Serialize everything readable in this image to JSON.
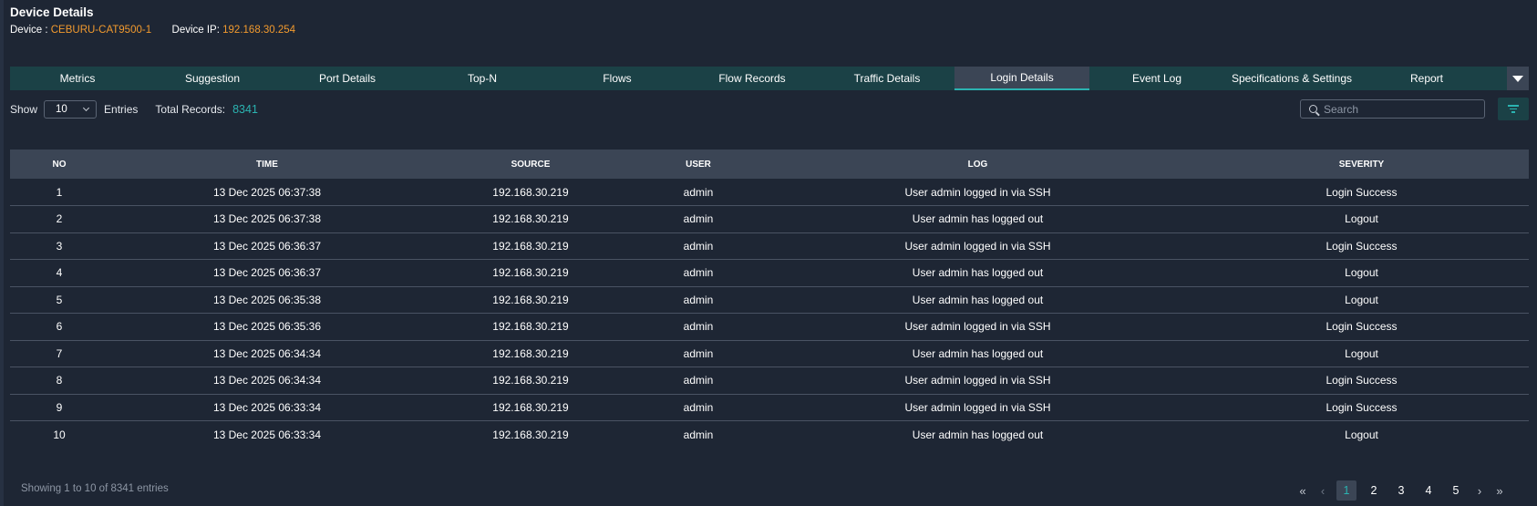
{
  "header": {
    "title": "Device Details",
    "device_label": "Device :",
    "device_value": "CEBURU-CAT9500-1",
    "ip_label": "Device IP:",
    "ip_value": "192.168.30.254"
  },
  "tabs": [
    "Metrics",
    "Suggestion",
    "Port Details",
    "Top-N",
    "Flows",
    "Flow Records",
    "Traffic Details",
    "Login Details",
    "Event Log",
    "Specifications & Settings",
    "Report"
  ],
  "active_tab": "Login Details",
  "controls": {
    "show_label": "Show",
    "entries_value": "10",
    "entries_label": "Entries",
    "total_label": "Total Records:",
    "total_value": "8341",
    "search_placeholder": "Search"
  },
  "table": {
    "columns": [
      "NO",
      "TIME",
      "SOURCE",
      "USER",
      "LOG",
      "SEVERITY"
    ],
    "rows": [
      [
        "1",
        "13 Dec 2025 06:37:38",
        "192.168.30.219",
        "admin",
        "User admin logged in via SSH",
        "Login Success"
      ],
      [
        "2",
        "13 Dec 2025 06:37:38",
        "192.168.30.219",
        "admin",
        "User admin has logged out",
        "Logout"
      ],
      [
        "3",
        "13 Dec 2025 06:36:37",
        "192.168.30.219",
        "admin",
        "User admin logged in via SSH",
        "Login Success"
      ],
      [
        "4",
        "13 Dec 2025 06:36:37",
        "192.168.30.219",
        "admin",
        "User admin has logged out",
        "Logout"
      ],
      [
        "5",
        "13 Dec 2025 06:35:38",
        "192.168.30.219",
        "admin",
        "User admin has logged out",
        "Logout"
      ],
      [
        "6",
        "13 Dec 2025 06:35:36",
        "192.168.30.219",
        "admin",
        "User admin logged in via SSH",
        "Login Success"
      ],
      [
        "7",
        "13 Dec 2025 06:34:34",
        "192.168.30.219",
        "admin",
        "User admin has logged out",
        "Logout"
      ],
      [
        "8",
        "13 Dec 2025 06:34:34",
        "192.168.30.219",
        "admin",
        "User admin logged in via SSH",
        "Login Success"
      ],
      [
        "9",
        "13 Dec 2025 06:33:34",
        "192.168.30.219",
        "admin",
        "User admin logged in via SSH",
        "Login Success"
      ],
      [
        "10",
        "13 Dec 2025 06:33:34",
        "192.168.30.219",
        "admin",
        "User admin has logged out",
        "Logout"
      ]
    ]
  },
  "footer": {
    "showing_text": "Showing 1 to 10 of 8341 entries",
    "pages": [
      "1",
      "2",
      "3",
      "4",
      "5"
    ],
    "current_page": "1",
    "nav": {
      "first": "«",
      "prev": "‹",
      "next": "›",
      "last": "»"
    }
  },
  "colors": {
    "background": "#1e2634",
    "tab_bar": "#1b4146",
    "accent_teal": "#2bb3b1",
    "accent_orange": "#f29a2e",
    "table_header": "#3b4555"
  },
  "icons": {
    "tab_more": "caret-down-icon",
    "search": "search-icon",
    "filter": "filter-icon",
    "select": "chevron-down-icon"
  }
}
